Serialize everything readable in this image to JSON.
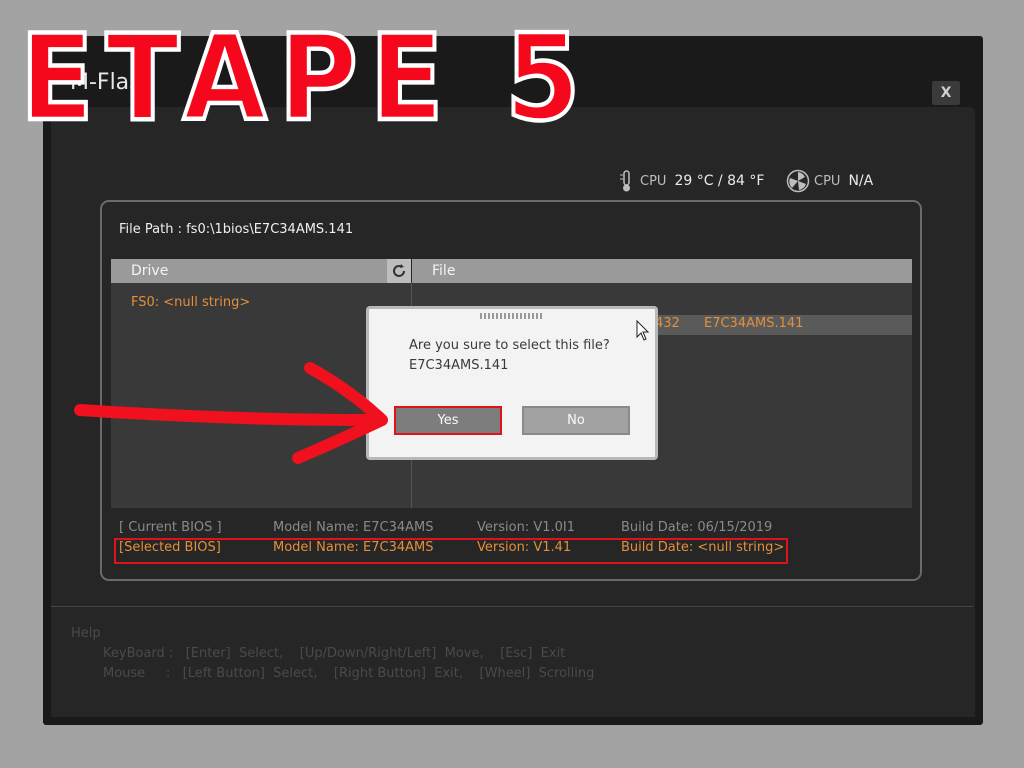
{
  "overlay": {
    "heading": "ETAPE 5"
  },
  "window": {
    "title": "M-Flash",
    "close_label": "X"
  },
  "sensors": {
    "cpu_temp_label": "CPU",
    "cpu_temp_value": "29 °C / 84 °F",
    "cpu_fan_label": "CPU",
    "cpu_fan_value": "N/A"
  },
  "file_path": "File Path :  fs0:\\1bios\\E7C34AMS.141",
  "columns": {
    "drive": "Drive",
    "file": "File"
  },
  "drives": [
    "FS0: <null string>"
  ],
  "files": [
    {
      "size": "432",
      "name": "E7C34AMS.141"
    }
  ],
  "current_bios": {
    "label": "[ Current BIOS  ]",
    "model": "Model Name: E7C34AMS",
    "version": "Version: V1.0I1",
    "build": "Build Date: 06/15/2019"
  },
  "selected_bios": {
    "label": "[Selected BIOS]",
    "model": "Model Name: E7C34AMS",
    "version": "Version: V1.41",
    "build": "Build Date: <null string>"
  },
  "help": {
    "title": "Help",
    "keyboard": "KeyBoard :   [Enter]  Select,    [Up/Down/Right/Left]  Move,    [Esc]  Exit",
    "mouse": "Mouse     :   [Left Button]  Select,    [Right Button]  Exit,    [Wheel]  Scrolling"
  },
  "dialog": {
    "question": "Are you sure to select this file?",
    "filename": "E7C34AMS.141",
    "yes_label": "Yes",
    "no_label": "No"
  },
  "colors": {
    "accent_orange": "#e38f3c",
    "highlight_red": "#e0121a"
  }
}
